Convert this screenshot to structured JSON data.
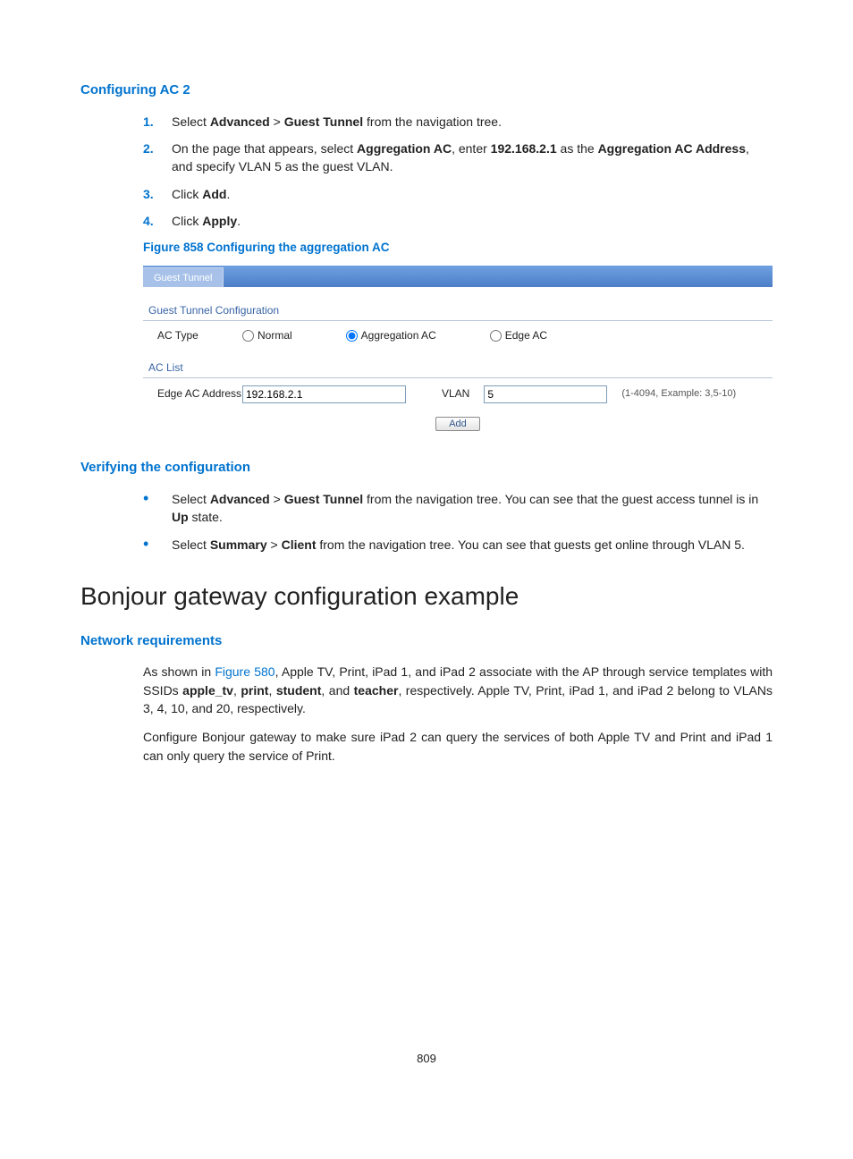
{
  "sec1": {
    "title": "Configuring AC 2",
    "steps": [
      {
        "n": "1.",
        "pre": "Select ",
        "b1": "Advanced",
        "mid1": " > ",
        "b2": "Guest Tunnel",
        "post": " from the navigation tree."
      },
      {
        "n": "2.",
        "pre": "On the page that appears, select ",
        "b1": "Aggregation AC",
        "mid1": ", enter ",
        "b2": "192.168.2.1",
        "mid2": " as the ",
        "b3": "Aggregation AC Address",
        "post": ", and specify VLAN 5 as the guest VLAN."
      },
      {
        "n": "3.",
        "pre": "Click ",
        "b1": "Add",
        "post": "."
      },
      {
        "n": "4.",
        "pre": "Click ",
        "b1": "Apply",
        "post": "."
      }
    ],
    "figcap": "Figure 858 Configuring the aggregation AC"
  },
  "shot": {
    "tab": "Guest Tunnel",
    "panel1": "Guest Tunnel Configuration",
    "actype": "AC Type",
    "r1": "Normal",
    "r2": "Aggregation AC",
    "r3": "Edge AC",
    "panel2": "AC List",
    "edgeaddr": "Edge AC Address",
    "ipval": "192.168.2.1",
    "vlan": "VLAN",
    "vlanval": "5",
    "hint": "(1-4094, Example: 3,5-10)",
    "addbtn": "Add"
  },
  "sec2": {
    "title": "Verifying the configuration",
    "bullets": [
      {
        "pre": "Select ",
        "b1": "Advanced",
        "mid1": " > ",
        "b2": "Guest Tunnel",
        "mid2": " from the navigation tree. You can see that the guest access tunnel is in ",
        "b3": "Up",
        "post": " state."
      },
      {
        "pre": "Select ",
        "b1": "Summary",
        "mid1": " > ",
        "b2": "Client",
        "post": " from the navigation tree. You can see that guests get online through VLAN 5."
      }
    ]
  },
  "h2": "Bonjour gateway configuration example",
  "sec3": {
    "title": "Network requirements",
    "p1a": "As shown in ",
    "p1link": "Figure 580",
    "p1b": ", Apple TV, Print, iPad 1, and iPad 2 associate with the AP through service templates with SSIDs ",
    "bapple": "apple_tv",
    "c1": ", ",
    "bprint": "print",
    "c2": ", ",
    "bstudent": "student",
    "c3": ", and ",
    "bteacher": "teacher",
    "p1c": ", respectively. Apple TV, Print, iPad 1, and iPad 2 belong to VLANs 3, 4, 10, and 20, respectively.",
    "p2": "Configure Bonjour gateway to make sure iPad 2 can query the services of both Apple TV and Print and iPad 1 can only query the service of Print."
  },
  "pagenum": "809"
}
